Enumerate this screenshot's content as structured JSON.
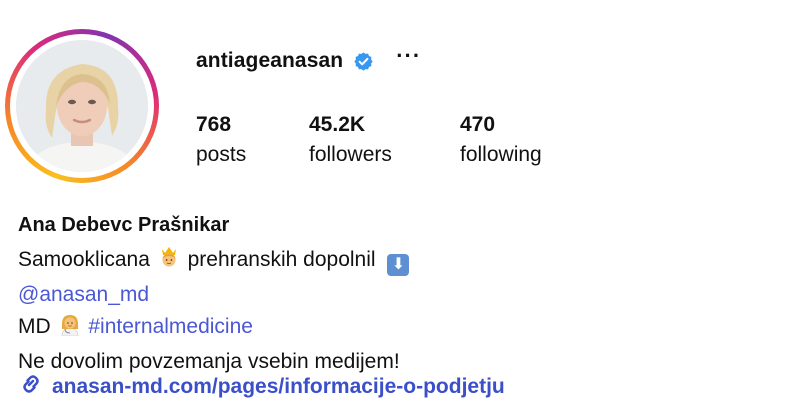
{
  "profile": {
    "username": "antiageanasan",
    "more_label": "···",
    "stats": {
      "posts_count": "768",
      "posts_label": "posts",
      "followers_count": "45.2K",
      "followers_label": "followers",
      "following_count": "470",
      "following_label": "following"
    }
  },
  "bio": {
    "name": "Ana Debevc Prašnikar",
    "line1_text_a": "Samooklicana",
    "line1_text_b": "prehranskih dopolnil",
    "mention": "@anasan_md",
    "line3_text": "MD",
    "hashtag": "#internalmedicine",
    "line4_text": "Ne dovolim povzemanja vsebin medijem!",
    "link_text": "anasan-md.com/pages/informacije-o-podjetju"
  },
  "icons": {
    "verified": "verified-badge-icon",
    "more": "more-options-icon",
    "crown_person": "person-with-crown-emoji",
    "down_arrow": "down-arrow-emoji",
    "health_worker": "health-worker-emoji",
    "link": "link-icon"
  },
  "colors": {
    "verified_blue": "#3897f0",
    "link_blue": "#3b4fc9",
    "mention_blue": "#4a58d3",
    "ring_gradient": [
      "#f9c01e",
      "#f58529",
      "#dd2a7b",
      "#8134af"
    ]
  }
}
